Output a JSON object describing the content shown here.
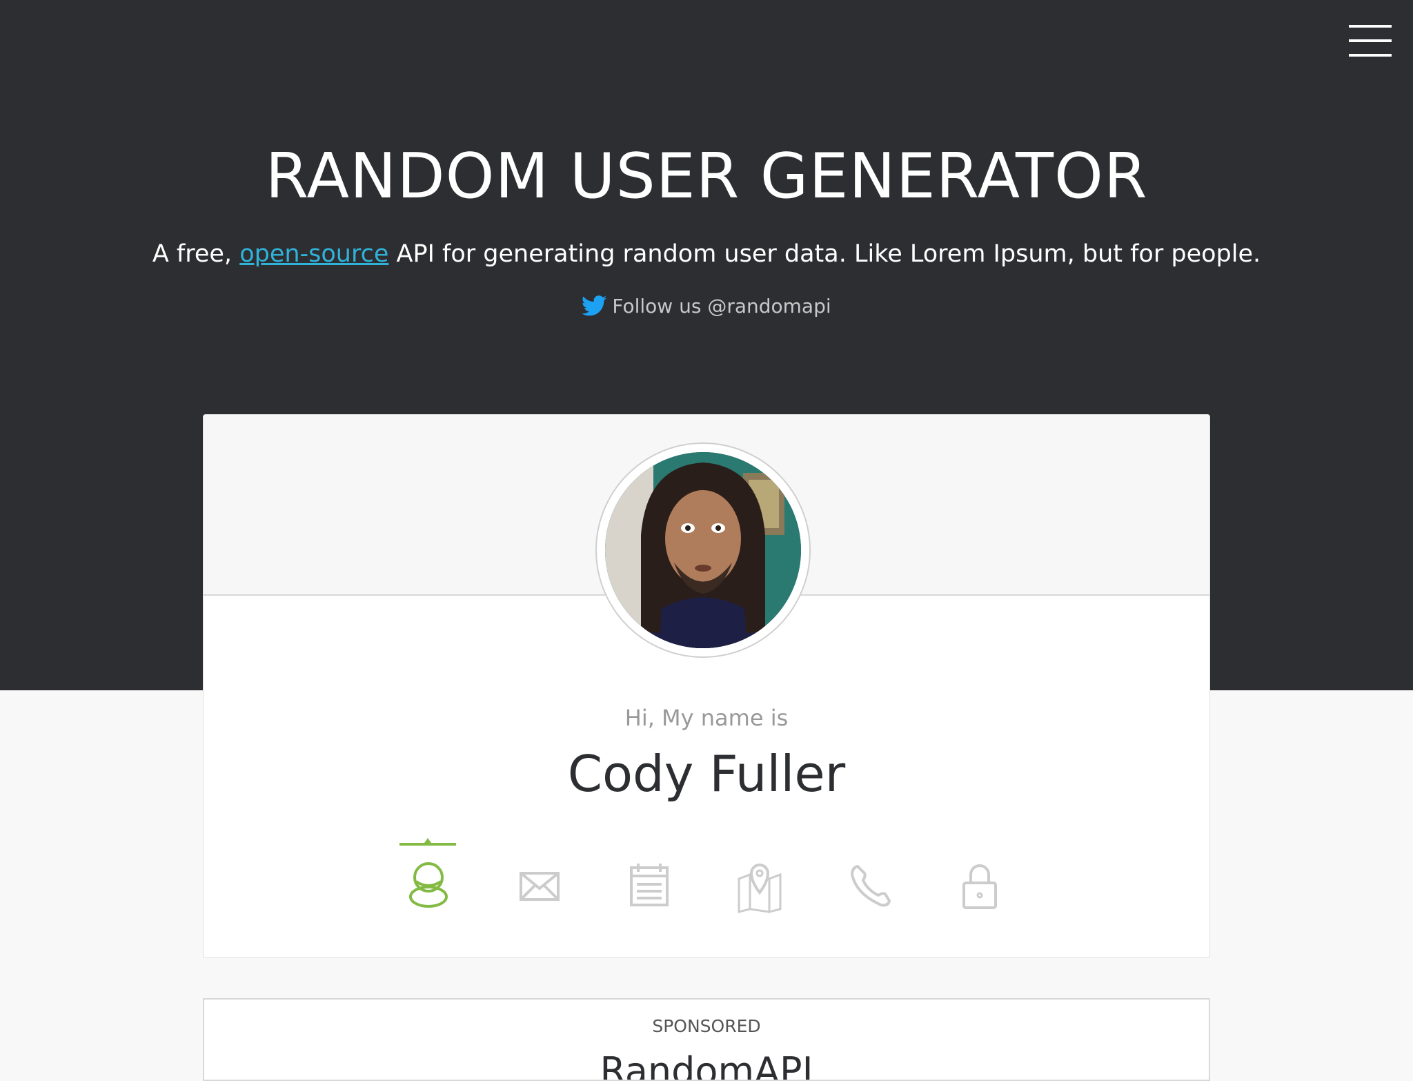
{
  "site": {
    "title": "RANDOM USER GENERATOR",
    "tagline_before": "A free, ",
    "tagline_link": "open-source",
    "tagline_after": " API for generating random user data. Like Lorem Ipsum, but for people.",
    "follow": "Follow us @randomapi"
  },
  "profile": {
    "label": "Hi, My name is",
    "name": "Cody Fuller",
    "active_tab": "name",
    "tabs": [
      {
        "id": "name",
        "icon": "user-icon",
        "active": true
      },
      {
        "id": "email",
        "icon": "envelope-icon",
        "active": false
      },
      {
        "id": "birthday",
        "icon": "calendar-icon",
        "active": false
      },
      {
        "id": "location",
        "icon": "map-icon",
        "active": false
      },
      {
        "id": "phone",
        "icon": "phone-icon",
        "active": false
      },
      {
        "id": "password",
        "icon": "lock-icon",
        "active": false
      }
    ]
  },
  "sponsored": {
    "label": "SPONSORED",
    "title": "RandomAPI"
  },
  "colors": {
    "hero_bg": "#2d2e32",
    "accent_green": "#83ba43",
    "link_blue": "#2fb3d9",
    "twitter_blue": "#1da1f2",
    "icon_gray": "#cccccc"
  }
}
